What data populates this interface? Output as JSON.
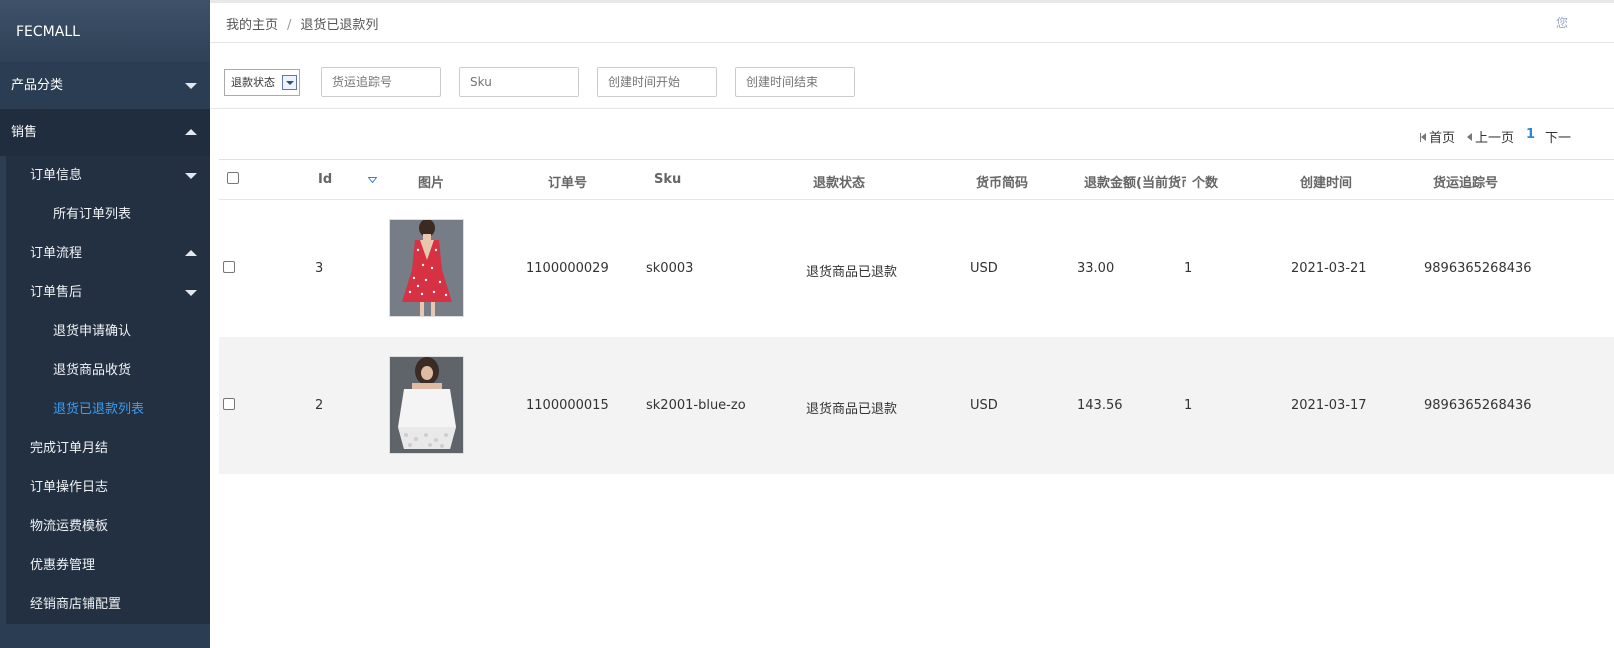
{
  "sidebar": {
    "brand": "FECMALL",
    "items": [
      {
        "label": "产品分类"
      },
      {
        "label": "销售"
      }
    ],
    "sub": {
      "order_info": "订单信息",
      "all_orders": "所有订单列表",
      "order_flow": "订单流程",
      "after_sale": "订单售后",
      "return_confirm": "退货申请确认",
      "return_receive": "退货商品收货",
      "return_refunded": "退货已退款列表",
      "monthly": "完成订单月结",
      "log": "订单操作日志",
      "shipping_tpl": "物流运费模板",
      "coupon": "优惠券管理",
      "distributor": "经销商店铺配置"
    }
  },
  "breadcrumb": {
    "home": "我的主页",
    "sep": "/",
    "current": "退货已退款列"
  },
  "header_corner": "您",
  "filters": {
    "status_label": "退款状态",
    "tracking_placeholder": "货运追踪号",
    "sku_placeholder": "Sku",
    "start_placeholder": "创建时间开始",
    "end_placeholder": "创建时间结束"
  },
  "pager": {
    "first": "首页",
    "prev": "上一页",
    "page": "1",
    "next": "下一"
  },
  "table": {
    "headers": {
      "id": "Id",
      "image": "图片",
      "order_no": "订单号",
      "sku": "Sku",
      "status": "退款状态",
      "currency": "货币简码",
      "amount": "退款金额(当前货币",
      "qty": "个数",
      "created": "创建时间",
      "tracking": "货运追踪号"
    },
    "rows": [
      {
        "id": "3",
        "order_no": "1100000029",
        "sku": "sk0003",
        "status": "退货商品已退款",
        "currency": "USD",
        "amount": "33.00",
        "qty": "1",
        "created": "2021-03-21",
        "tracking": "9896365268436"
      },
      {
        "id": "2",
        "order_no": "1100000015",
        "sku": "sk2001-blue-zo",
        "status": "退货商品已退款",
        "currency": "USD",
        "amount": "143.56",
        "qty": "1",
        "created": "2021-03-17",
        "tracking": "9896365268436"
      }
    ]
  },
  "colors": {
    "sidebar_bg": "#2b3d52",
    "submenu_bg": "#223041",
    "active_link": "#3c9cf1",
    "page_num": "#2e86d9"
  }
}
